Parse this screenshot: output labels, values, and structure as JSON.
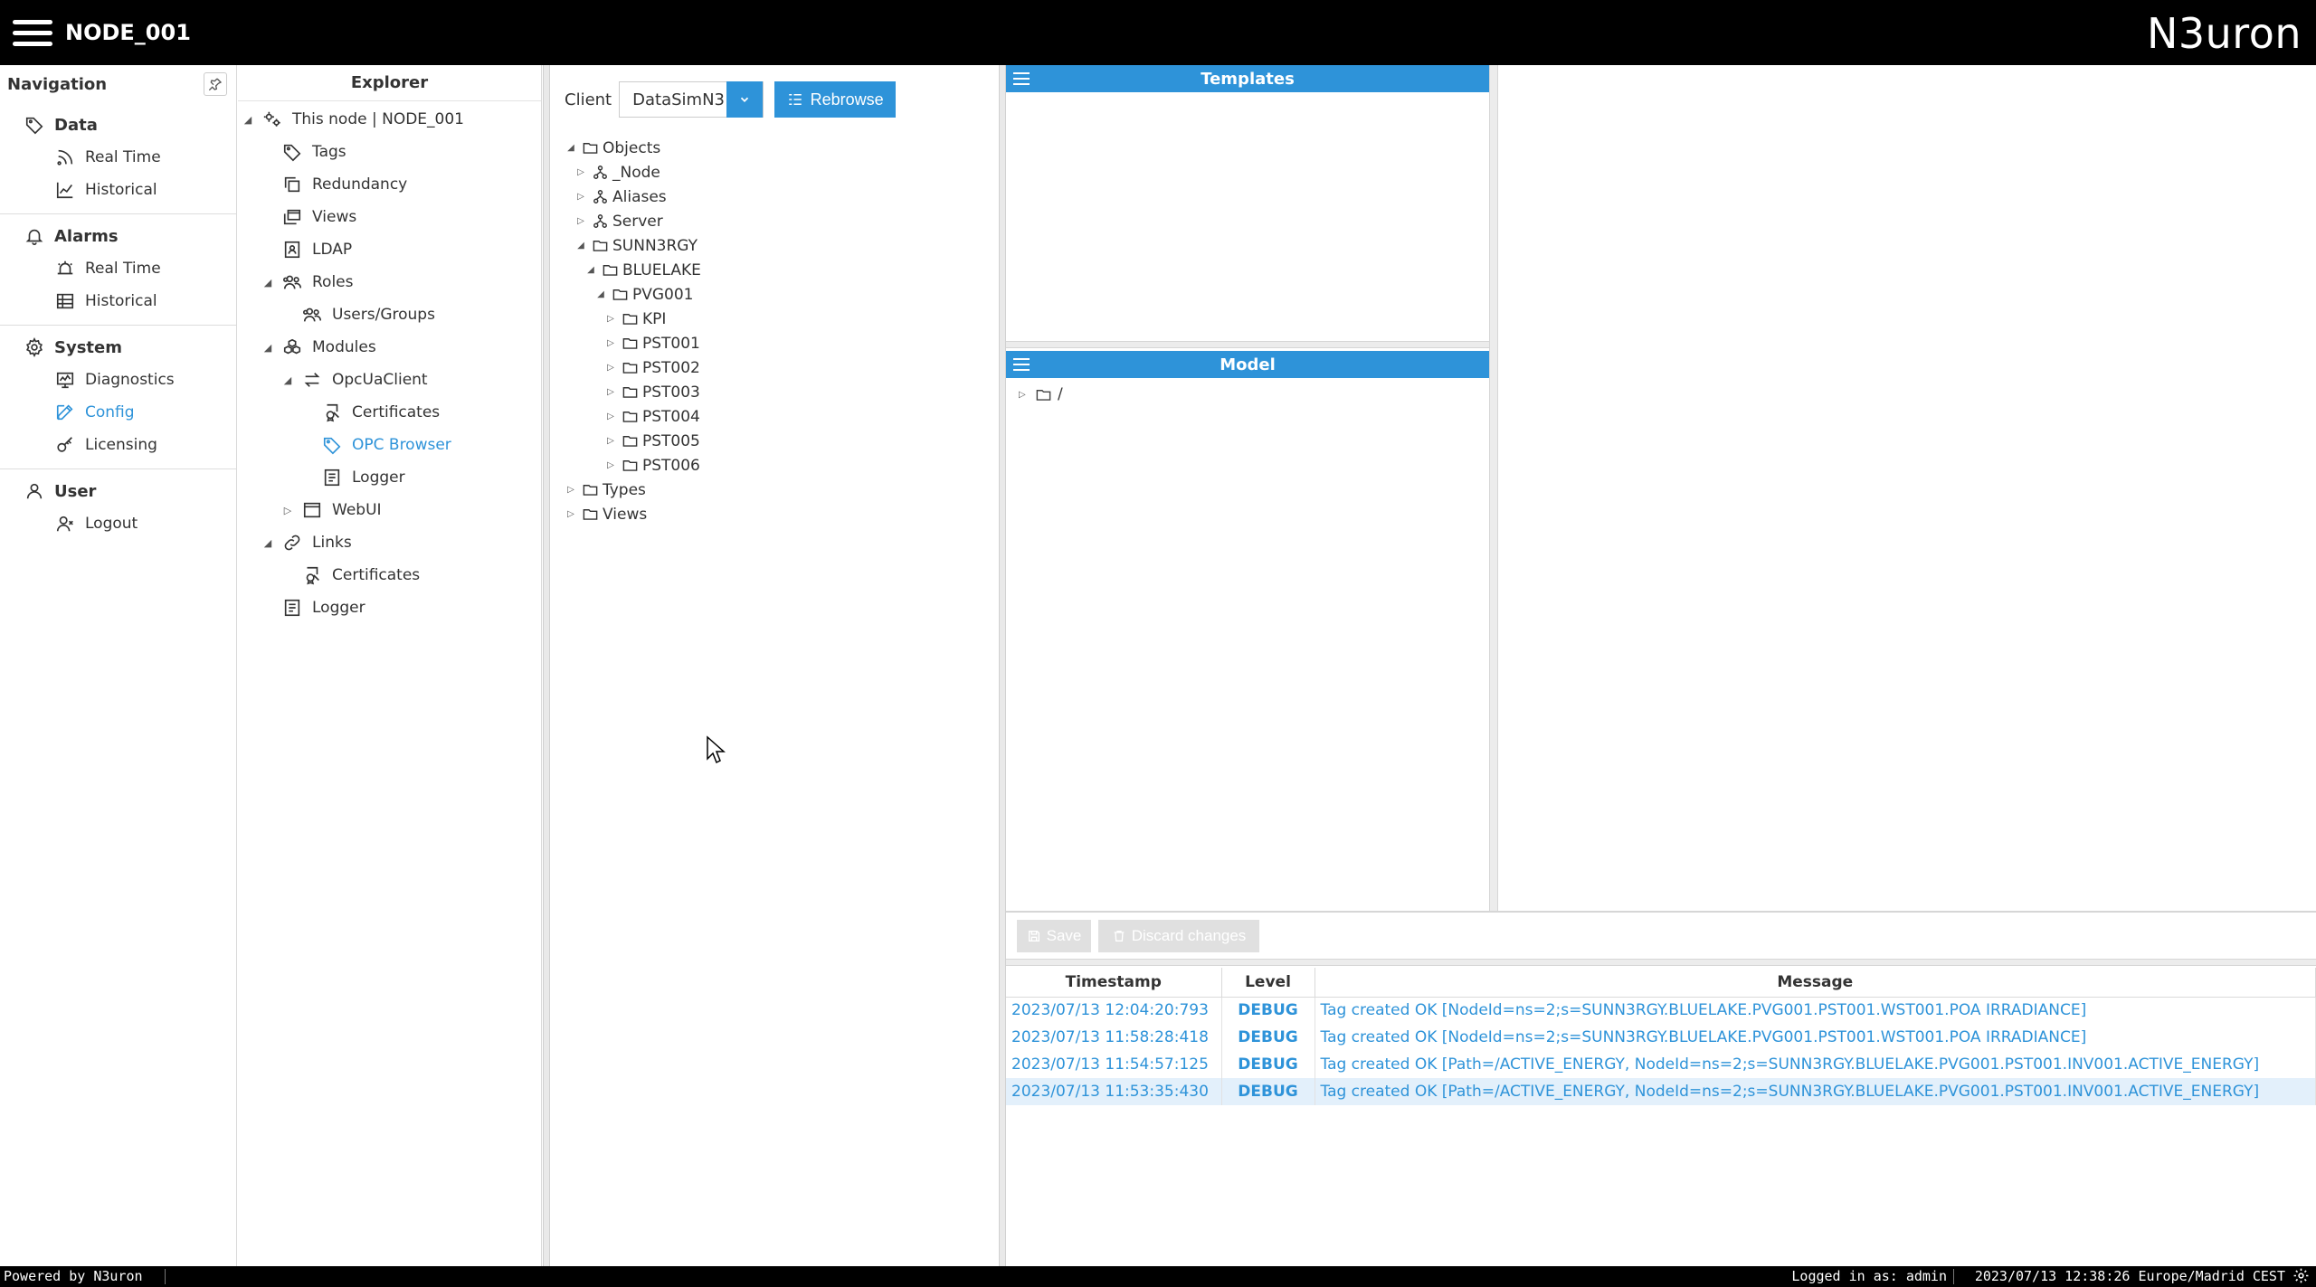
{
  "app": {
    "node_title": "NODE_001",
    "brand": "N3uron"
  },
  "navigation": {
    "header": "Navigation",
    "sections": [
      {
        "title": "Data",
        "icon": "tag-icon",
        "items": [
          {
            "label": "Real Time",
            "icon": "rss-icon"
          },
          {
            "label": "Historical",
            "icon": "line-chart-icon"
          }
        ]
      },
      {
        "title": "Alarms",
        "icon": "bell-icon",
        "items": [
          {
            "label": "Real Time",
            "icon": "alarm-realtime-icon"
          },
          {
            "label": "Historical",
            "icon": "table-icon"
          }
        ]
      },
      {
        "title": "System",
        "icon": "gear-icon",
        "items": [
          {
            "label": "Diagnostics",
            "icon": "monitor-icon"
          },
          {
            "label": "Config",
            "icon": "edit-icon",
            "active": true
          },
          {
            "label": "Licensing",
            "icon": "key-icon"
          }
        ]
      },
      {
        "title": "User",
        "icon": "user-icon",
        "items": [
          {
            "label": "Logout",
            "icon": "user-x-icon"
          }
        ]
      }
    ]
  },
  "explorer": {
    "header": "Explorer",
    "items": [
      {
        "label": "This node | NODE_001",
        "icon": "node-gears-icon",
        "level": 0,
        "toggle": "expanded"
      },
      {
        "label": "Tags",
        "icon": "tag-icon",
        "level": 1
      },
      {
        "label": "Redundancy",
        "icon": "copy-icon",
        "level": 1
      },
      {
        "label": "Views",
        "icon": "windows-icon",
        "level": 1
      },
      {
        "label": "LDAP",
        "icon": "id-card-icon",
        "level": 1
      },
      {
        "label": "Roles",
        "icon": "users-icon",
        "level": 1,
        "toggle": "expanded"
      },
      {
        "label": "Users/Groups",
        "icon": "users-icon",
        "level": 2
      },
      {
        "label": "Modules",
        "icon": "cubes-icon",
        "level": 1,
        "toggle": "expanded"
      },
      {
        "label": "OpcUaClient",
        "icon": "exchange-icon",
        "level": 2,
        "toggle": "expanded"
      },
      {
        "label": "Certificates",
        "icon": "certificate-icon",
        "level": 3
      },
      {
        "label": "OPC Browser",
        "icon": "tag-icon",
        "level": 3,
        "active": true
      },
      {
        "label": "Logger",
        "icon": "log-icon",
        "level": 3
      },
      {
        "label": "WebUI",
        "icon": "window-icon",
        "level": 2,
        "toggle": "collapsed"
      },
      {
        "label": "Links",
        "icon": "link-icon",
        "level": 1,
        "toggle": "expanded"
      },
      {
        "label": "Certificates",
        "icon": "certificate-icon",
        "level": 2
      },
      {
        "label": "Logger",
        "icon": "log-icon",
        "level": 1
      }
    ]
  },
  "browser": {
    "client_label": "Client",
    "client_value": "DataSimN3",
    "rebrowse_label": "Rebrowse",
    "tree": [
      {
        "label": "Objects",
        "level": 0,
        "toggle": "expanded",
        "icon": "folder-icon"
      },
      {
        "label": "_Node",
        "level": 1,
        "toggle": "collapsed",
        "icon": "hierarchy-icon"
      },
      {
        "label": "Aliases",
        "level": 1,
        "toggle": "collapsed",
        "icon": "hierarchy-icon"
      },
      {
        "label": "Server",
        "level": 1,
        "toggle": "collapsed",
        "icon": "hierarchy-icon"
      },
      {
        "label": "SUNN3RGY",
        "level": 1,
        "toggle": "expanded",
        "icon": "folder-icon"
      },
      {
        "label": "BLUELAKE",
        "level": 2,
        "toggle": "expanded",
        "icon": "folder-icon"
      },
      {
        "label": "PVG001",
        "level": 3,
        "toggle": "expanded",
        "icon": "folder-icon"
      },
      {
        "label": "KPI",
        "level": 4,
        "toggle": "collapsed",
        "icon": "folder-icon"
      },
      {
        "label": "PST001",
        "level": 4,
        "toggle": "collapsed",
        "icon": "folder-icon"
      },
      {
        "label": "PST002",
        "level": 4,
        "toggle": "collapsed",
        "icon": "folder-icon"
      },
      {
        "label": "PST003",
        "level": 4,
        "toggle": "collapsed",
        "icon": "folder-icon"
      },
      {
        "label": "PST004",
        "level": 4,
        "toggle": "collapsed",
        "icon": "folder-icon"
      },
      {
        "label": "PST005",
        "level": 4,
        "toggle": "collapsed",
        "icon": "folder-icon"
      },
      {
        "label": "PST006",
        "level": 4,
        "toggle": "collapsed",
        "icon": "folder-icon"
      },
      {
        "label": "Types",
        "level": 0,
        "toggle": "collapsed",
        "icon": "folder-icon"
      },
      {
        "label": "Views",
        "level": 0,
        "toggle": "collapsed",
        "icon": "folder-icon"
      }
    ]
  },
  "templates": {
    "header": "Templates"
  },
  "model": {
    "header": "Model",
    "root_label": "/"
  },
  "actions": {
    "save_label": "Save",
    "discard_label": "Discard changes"
  },
  "log": {
    "columns": [
      "Timestamp",
      "Level",
      "Message"
    ],
    "rows": [
      {
        "timestamp": "2023/07/13 12:04:20:793",
        "level": "DEBUG",
        "message": "Tag created OK [NodeId=ns=2;s=SUNN3RGY.BLUELAKE.PVG001.PST001.WST001.POA IRRADIANCE]"
      },
      {
        "timestamp": "2023/07/13 11:58:28:418",
        "level": "DEBUG",
        "message": "Tag created OK [NodeId=ns=2;s=SUNN3RGY.BLUELAKE.PVG001.PST001.WST001.POA IRRADIANCE]"
      },
      {
        "timestamp": "2023/07/13 11:54:57:125",
        "level": "DEBUG",
        "message": "Tag created OK [Path=/ACTIVE_ENERGY, NodeId=ns=2;s=SUNN3RGY.BLUELAKE.PVG001.PST001.INV001.ACTIVE_ENERGY]"
      },
      {
        "timestamp": "2023/07/13 11:53:35:430",
        "level": "DEBUG",
        "message": "Tag created OK [Path=/ACTIVE_ENERGY, NodeId=ns=2;s=SUNN3RGY.BLUELAKE.PVG001.PST001.INV001.ACTIVE_ENERGY]",
        "selected": true
      }
    ]
  },
  "footer": {
    "powered": "Powered by N3uron",
    "logged_in": "Logged in as: admin",
    "clock": "2023/07/13 12:38:26 Europe/Madrid CEST"
  },
  "colors": {
    "accent": "#2e93d9",
    "topbar": "#000000",
    "selected_row": "#e3f0fb"
  }
}
